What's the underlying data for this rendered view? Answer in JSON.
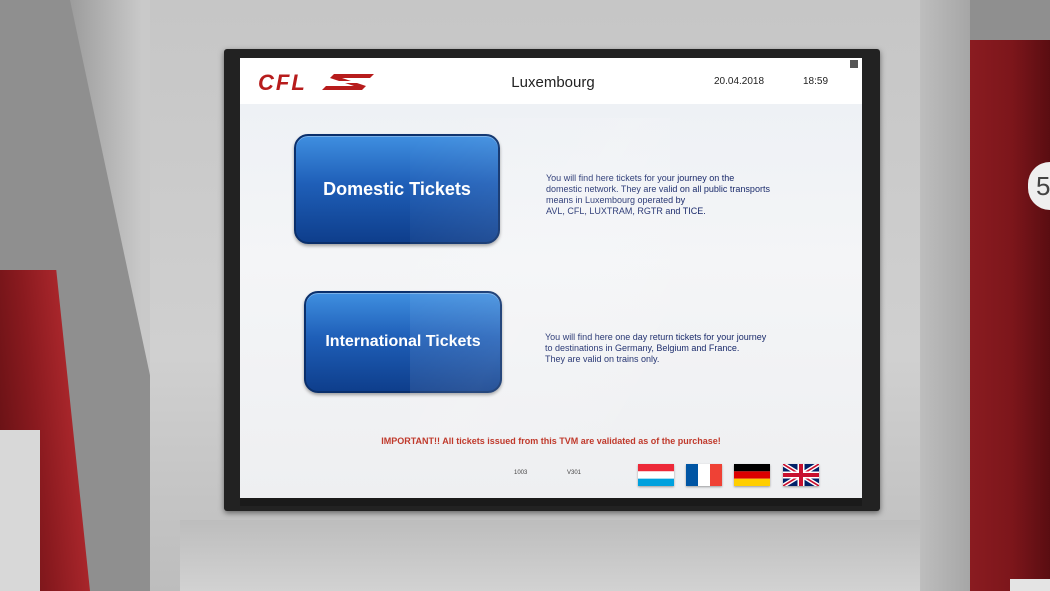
{
  "header": {
    "logo_text": "CFL",
    "station": "Luxembourg",
    "date": "20.04.2018",
    "time": "18:59"
  },
  "buttons": {
    "domestic_label": "Domestic Tickets",
    "international_label": "International Tickets"
  },
  "descriptions": {
    "domestic": [
      "You will find here tickets for your journey on the",
      "domestic network. They are valid on all public transports",
      "means in Luxembourg operated by",
      "AVL, CFL, LUXTRAM, RGTR and TICE."
    ],
    "international": [
      "You will find here one day return tickets for your journey",
      "to destinations in Germany, Belgium and France.",
      "They are valid on trains only."
    ]
  },
  "notice": "IMPORTANT!! All tickets issued from this TVM are validated as of the purchase!",
  "footer": {
    "code_left": "1003",
    "code_right": "V301"
  },
  "languages": [
    "luxembourgish-flag",
    "french-flag",
    "german-flag",
    "uk-flag"
  ],
  "side_label": "5",
  "colors": {
    "brand_red": "#b71c1c",
    "button_blue": "#1f5fb8",
    "notice_red": "#c0392b"
  }
}
